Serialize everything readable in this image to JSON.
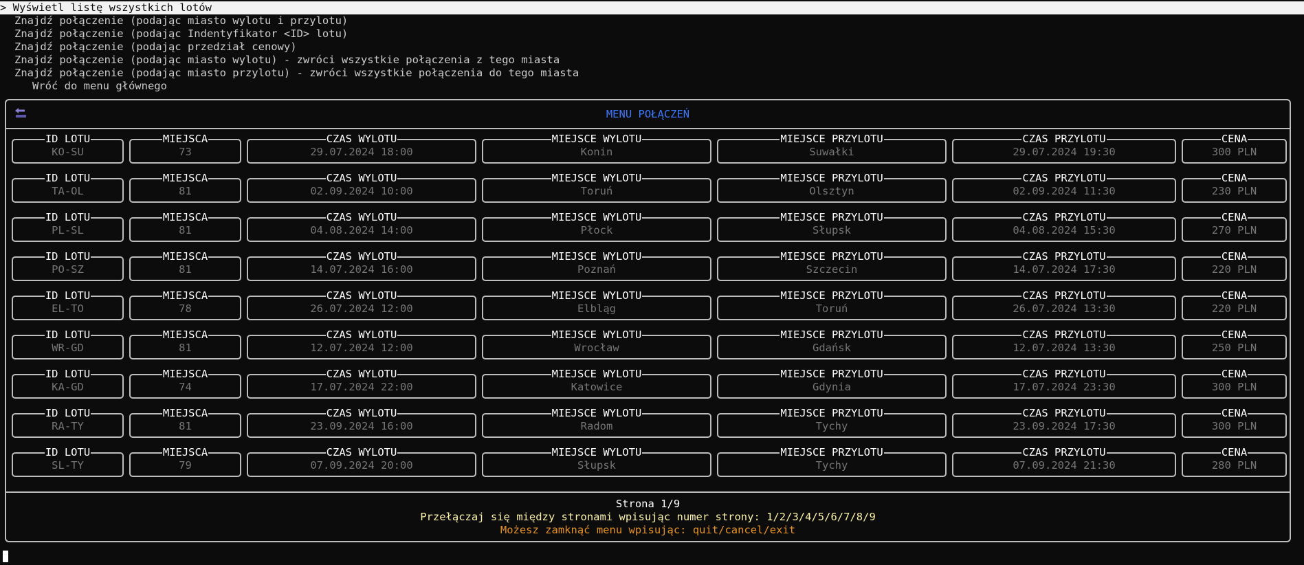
{
  "menu": {
    "items": [
      {
        "label": "> Wyświetl listę wszystkich lotów",
        "selected": true
      },
      {
        "label": "Znajdź połączenie (podając miasto wylotu i przylotu)",
        "selected": false
      },
      {
        "label": "Znajdź połączenie (podając Indentyfikator <ID> lotu)",
        "selected": false
      },
      {
        "label": "Znajdź połączenie (podając przedział cenowy)",
        "selected": false
      },
      {
        "label": "Znajdź połączenie (podając miasto wylotu) - zwróci wszystkie połączenia z tego miasta",
        "selected": false
      },
      {
        "label": "Znajdź połączenie (podając miasto przylotu) - zwróci wszystkie połączenia do tego miasta",
        "selected": false
      }
    ],
    "back_label": "Wróć do menu głównego",
    "back_icon": "back-arrow-icon"
  },
  "panel": {
    "title": "MENU POŁĄCZEŃ",
    "columns": [
      "ID LOTU",
      "MIEJSCA",
      "CZAS WYLOTU",
      "MIEJSCE WYLOTU",
      "MIEJSCE PRZYLOTU",
      "CZAS PRZYLOTU",
      "CENA"
    ],
    "rows": [
      [
        "KO-SU",
        "73",
        "29.07.2024 18:00",
        "Konin",
        "Suwałki",
        "29.07.2024 19:30",
        "300 PLN"
      ],
      [
        "TA-OL",
        "81",
        "02.09.2024 10:00",
        "Toruń",
        "Olsztyn",
        "02.09.2024 11:30",
        "230 PLN"
      ],
      [
        "PL-SL",
        "81",
        "04.08.2024 14:00",
        "Płock",
        "Słupsk",
        "04.08.2024 15:30",
        "270 PLN"
      ],
      [
        "PO-SZ",
        "81",
        "14.07.2024 16:00",
        "Poznań",
        "Szczecin",
        "14.07.2024 17:30",
        "220 PLN"
      ],
      [
        "EL-TO",
        "78",
        "26.07.2024 12:00",
        "Elbląg",
        "Toruń",
        "26.07.2024 13:30",
        "220 PLN"
      ],
      [
        "WR-GD",
        "81",
        "12.07.2024 12:00",
        "Wrocław",
        "Gdańsk",
        "12.07.2024 13:30",
        "250 PLN"
      ],
      [
        "KA-GD",
        "74",
        "17.07.2024 22:00",
        "Katowice",
        "Gdynia",
        "17.07.2024 23:30",
        "300 PLN"
      ],
      [
        "RA-TY",
        "81",
        "23.09.2024 16:00",
        "Radom",
        "Tychy",
        "23.09.2024 17:30",
        "300 PLN"
      ],
      [
        "SL-TY",
        "79",
        "07.09.2024 20:00",
        "Słupsk",
        "Tychy",
        "07.09.2024 21:30",
        "280 PLN"
      ]
    ],
    "page_label": "Strona 1/9",
    "page_hint": "Przełączaj się między stronami wpisując numer strony: 1/2/3/4/5/6/7/8/9",
    "quit_hint": "Możesz zamknąć menu wpisując: quit/cancel/exit"
  },
  "colors": {
    "background": "#0c0c0c",
    "title": "#3b78ff",
    "hint": "#f9f1a5",
    "quit": "#e8921f",
    "value": "#767676"
  }
}
